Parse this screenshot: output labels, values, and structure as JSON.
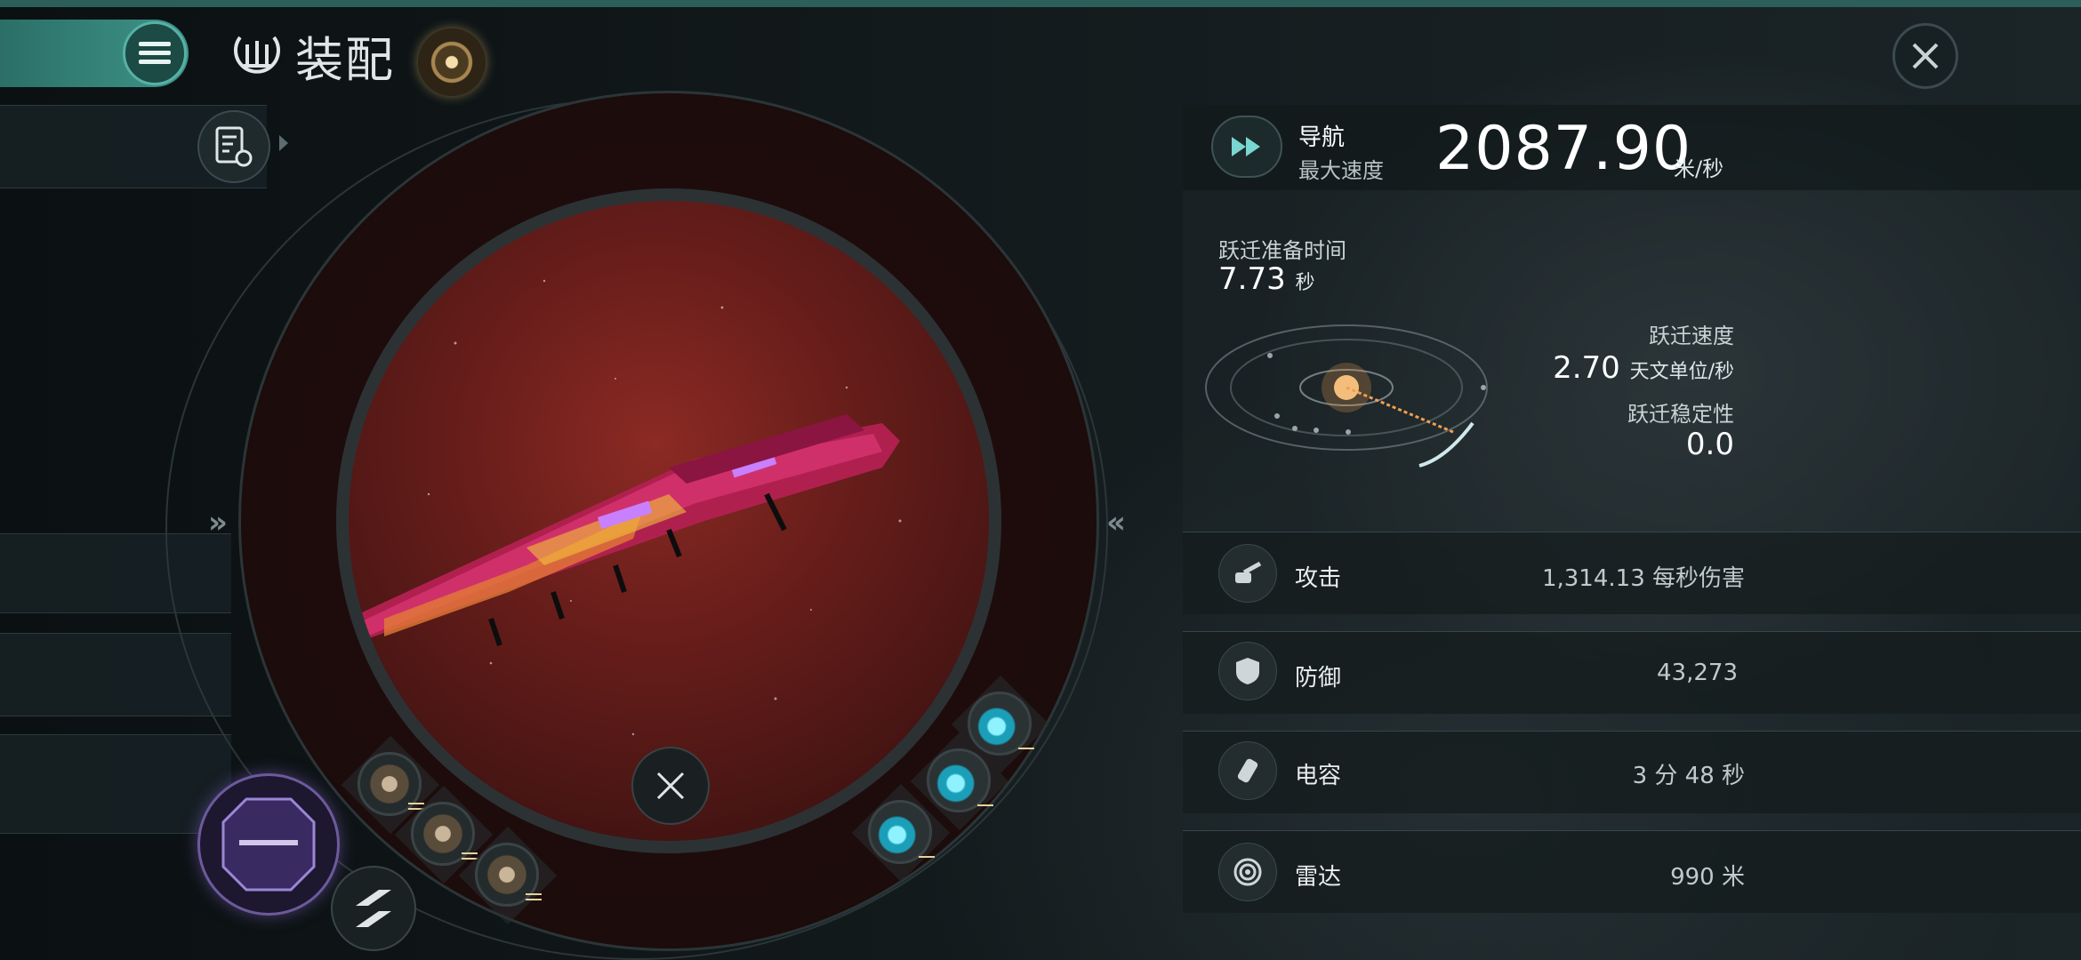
{
  "header": {
    "title": "装配",
    "title_icon": "fitting-emblem-icon",
    "menu_icon": "hamburger-menu-icon",
    "close_icon": "close-icon"
  },
  "left_panel": {
    "fitting_icon": "fitting-settings-icon",
    "expand_left": "»",
    "expand_right": "«"
  },
  "navigation": {
    "label": "导航",
    "sub_label": "最大速度",
    "value": "2087.90",
    "unit": "米/秒"
  },
  "warp": {
    "prep_label": "跃迁准备时间",
    "prep_value": "7.73",
    "prep_unit": "秒",
    "speed_label": "跃迁速度",
    "speed_value": "2.70",
    "speed_unit": "天文单位/秒",
    "stability_label": "跃迁稳定性",
    "stability_value": "0.0"
  },
  "stats": [
    {
      "icon": "turret-icon",
      "label": "攻击",
      "value": "1,314.13 每秒伤害"
    },
    {
      "icon": "shield-icon",
      "label": "防御",
      "value": "43,273"
    },
    {
      "icon": "capacitor-icon",
      "label": "电容",
      "value": "3 分 48 秒"
    },
    {
      "icon": "radar-icon",
      "label": "雷达",
      "value": "990 米"
    }
  ],
  "colors": {
    "accent": "#3e9489",
    "viewport_red": "#6a1e1b",
    "ship_magenta": "#d0306a",
    "cyan_module": "#1b9fb8",
    "ship_card_purple": "#6d5a9c"
  }
}
